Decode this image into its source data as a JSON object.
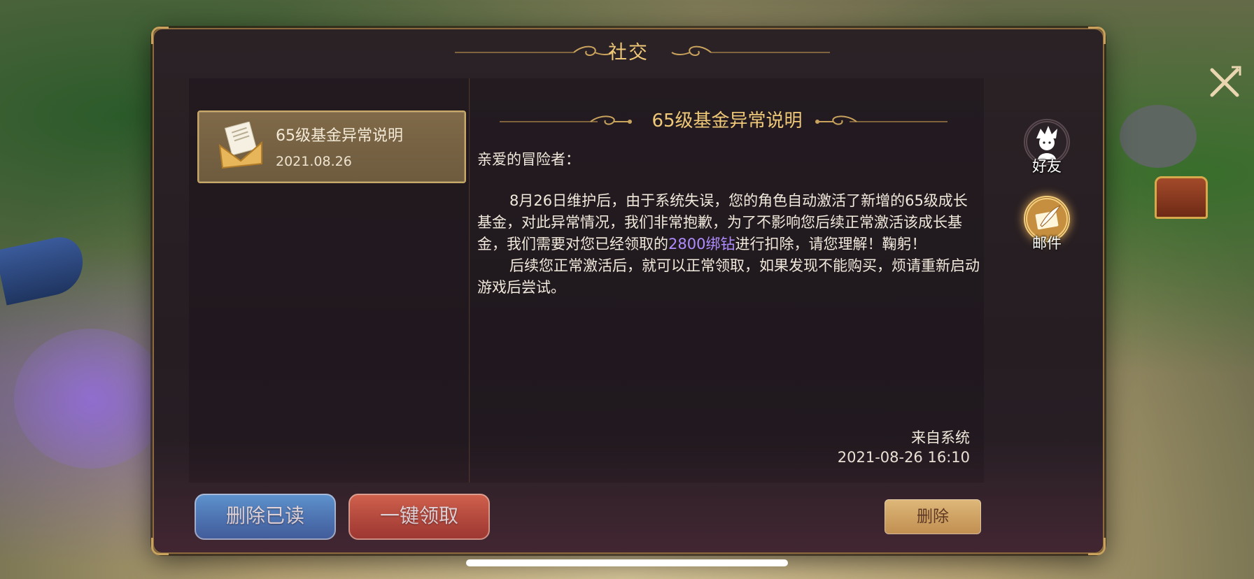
{
  "panel": {
    "title": "社交",
    "close_icon": "close-icon"
  },
  "mail_list": {
    "items": [
      {
        "title": "65级基金异常说明",
        "date": "2021.08.26",
        "icon": "envelope-icon",
        "selected": true
      }
    ]
  },
  "mail_content": {
    "title": "65级基金异常说明",
    "greeting": "亲爱的冒险者：",
    "paragraph1_before": "8月26日维护后，由于系统失误，您的角色自动激活了新增的65级成长基金，对此异常情况，我们非常抱歉，为了不影响您后续正常激活该成长基金，我们需要对您已经领取的",
    "paragraph1_highlight": "2800绑钻",
    "paragraph1_after": "进行扣除，请您理解！鞠躬！",
    "paragraph2": "后续您正常激活后，就可以正常领取，如果发现不能购买，烦请重新启动游戏后尝试。",
    "sender": "来自系统",
    "sent_time": "2021-08-26  16:10"
  },
  "side_tabs": [
    {
      "label": "好友",
      "icon": "friend-avatar-icon",
      "active": false
    },
    {
      "label": "邮件",
      "icon": "mail-quill-icon",
      "active": true
    }
  ],
  "buttons": {
    "delete_read": "删除已读",
    "claim_all": "一键领取",
    "delete": "删除"
  },
  "colors": {
    "title_gold": "#f0c978",
    "highlight_purple": "#b08cff",
    "panel_bg": "#2b2226"
  }
}
